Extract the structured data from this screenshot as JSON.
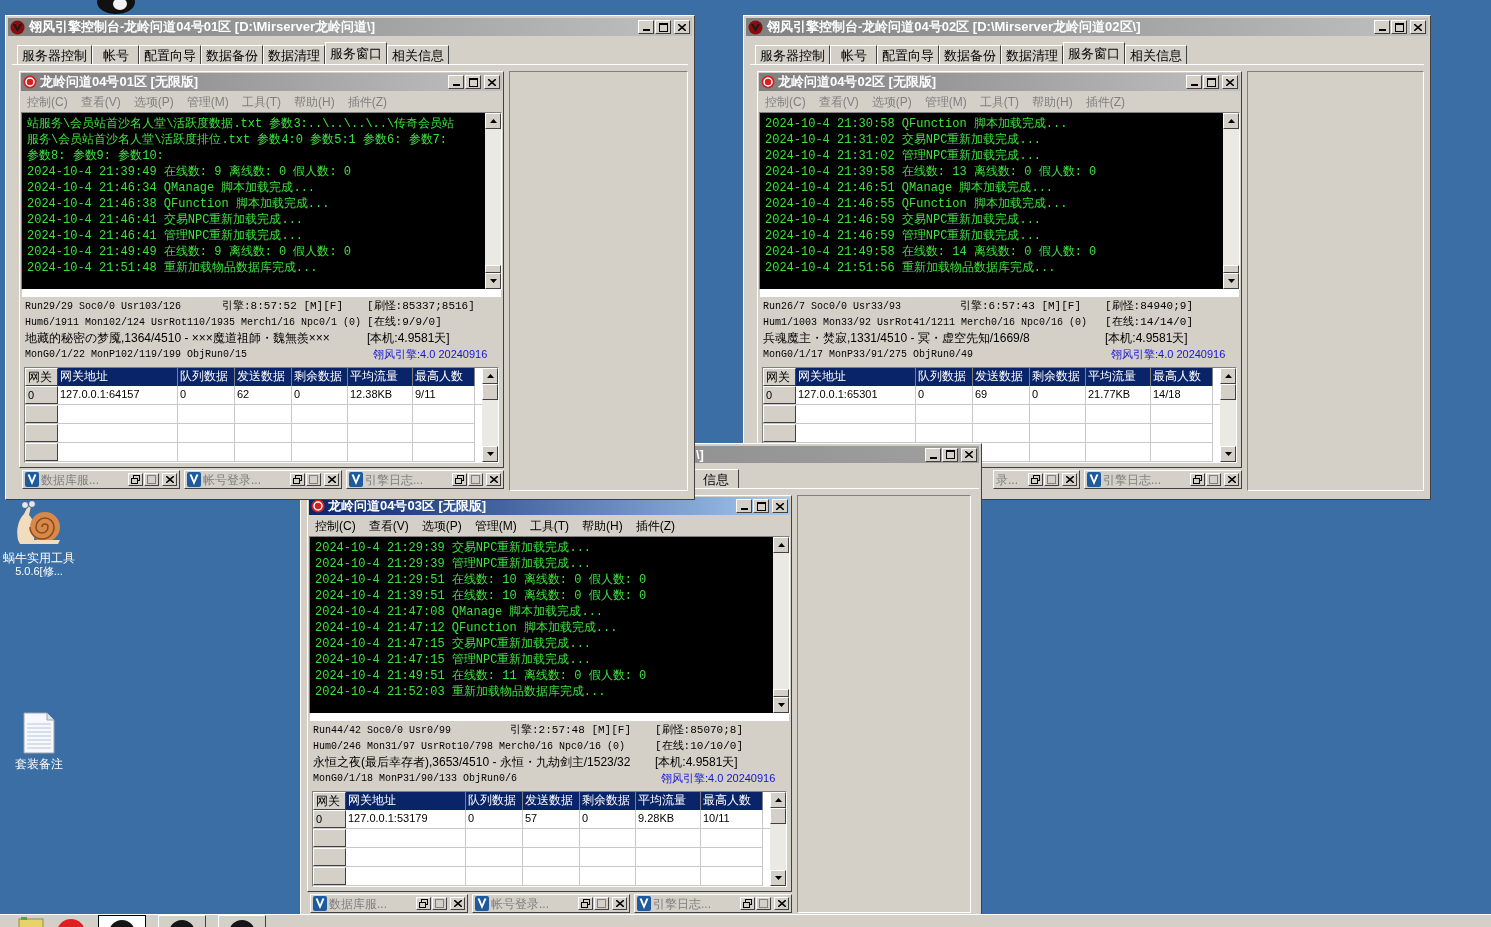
{
  "desktop": {
    "icons": [
      {
        "kind": "snail",
        "label": "蜗牛实用工具",
        "sublabel": "5.0.6[修..."
      },
      {
        "kind": "document",
        "label": "套装备注"
      }
    ]
  },
  "windows": [
    {
      "title": "翎风引擎控制台-龙岭问道04号01区 [D:\\Mirserver龙岭问道\\]",
      "tabs": [
        {
          "label": "服务器控制",
          "selected": false
        },
        {
          "label": "帐号",
          "selected": false
        },
        {
          "label": "配置向导",
          "selected": false
        },
        {
          "label": "数据备份",
          "selected": false
        },
        {
          "label": "数据清理",
          "selected": false
        },
        {
          "label": "服务窗口",
          "selected": true
        },
        {
          "label": "相关信息",
          "selected": false
        }
      ],
      "child": {
        "title": "龙岭问道04号01区 [无限版]",
        "active": false,
        "menu": [
          "控制(C)",
          "查看(V)",
          "选项(P)",
          "管理(M)",
          "工具(T)",
          "帮助(H)",
          "插件(Z)"
        ],
        "log": [
          "站服务\\会员站首沙名人堂\\活跃度数据.txt 参数3:..\\..\\..\\..\\传奇会员站",
          "服务\\会员站首沙名人堂\\活跃度排位.txt 参数4:0 参数5:1 参数6: 参数7:",
          "参数8: 参数9: 参数10:",
          "2024-10-4 21:39:49 在线数: 9 离线数: 0 假人数: 0",
          "2024-10-4 21:46:34 QManage 脚本加载完成...",
          "2024-10-4 21:46:38 QFunction 脚本加载完成...",
          "2024-10-4 21:46:41 交易NPC重新加载完成...",
          "2024-10-4 21:46:41 管理NPC重新加载完成...",
          "2024-10-4 21:49:49 在线数: 9 离线数: 0 假人数: 0",
          "2024-10-4 21:51:48 重新加载物品数据库完成..."
        ],
        "status": [
          {
            "kind": "counters",
            "cells": [
              "Run29/29 Soc0/0 Usr103/126",
              "引擎:8:57:52 [M][F]",
              "[刷怪:85337;8516]"
            ]
          },
          {
            "kind": "counters",
            "cells": [
              "Hum6/1911 Mon102/124 UsrRot110/1935 Merch1/16 Npc0/1 (0)",
              "[在线:9/9/0]"
            ]
          },
          {
            "kind": "names",
            "cells": [
              "地藏的秘密の梦魇,1364/4510 - ×××魔道祖師・魏無羨×××",
              "[本机:4.9581天]"
            ]
          },
          {
            "kind": "counters",
            "cells": [
              "MonG0/1/22 MonP102/119/199 ObjRun0/15"
            ],
            "version": "翎风引擎:4.0 20240916"
          }
        ],
        "table": {
          "columns": [
            "网关",
            "网关地址",
            "队列数据",
            "发送数据",
            "剩余数据",
            "平均流量",
            "最高人数"
          ],
          "rows": [
            [
              "0",
              "127.0.0.1:64157",
              "0",
              "62",
              "0",
              "12.38KB",
              "9/11"
            ]
          ]
        }
      },
      "minimized": [
        {
          "kind": "full",
          "label": "数据库服..."
        },
        {
          "kind": "full",
          "label": "帐号登录..."
        },
        {
          "kind": "full",
          "label": "引擎日志..."
        }
      ]
    },
    {
      "title": "翎风引擎控制台-龙岭问道04号02区 [D:\\Mirserver龙岭问道02区\\]",
      "tabs": [
        {
          "label": "服务器控制",
          "selected": false
        },
        {
          "label": "帐号",
          "selected": false
        },
        {
          "label": "配置向导",
          "selected": false
        },
        {
          "label": "数据备份",
          "selected": false
        },
        {
          "label": "数据清理",
          "selected": false
        },
        {
          "label": "服务窗口",
          "selected": true
        },
        {
          "label": "相关信息",
          "selected": false
        }
      ],
      "child": {
        "title": "龙岭问道04号02区 [无限版]",
        "active": false,
        "menu": [
          "控制(C)",
          "查看(V)",
          "选项(P)",
          "管理(M)",
          "工具(T)",
          "帮助(H)",
          "插件(Z)"
        ],
        "log": [
          "2024-10-4 21:30:58 QFunction 脚本加载完成...",
          "2024-10-4 21:31:02 交易NPC重新加载完成...",
          "2024-10-4 21:31:02 管理NPC重新加载完成...",
          "2024-10-4 21:39:58 在线数: 13 离线数: 0 假人数: 0",
          "2024-10-4 21:46:51 QManage 脚本加载完成...",
          "2024-10-4 21:46:55 QFunction 脚本加载完成...",
          "2024-10-4 21:46:59 交易NPC重新加载完成...",
          "2024-10-4 21:46:59 管理NPC重新加载完成...",
          "2024-10-4 21:49:58 在线数: 14 离线数: 0 假人数: 0",
          "2024-10-4 21:51:56 重新加载物品数据库完成..."
        ],
        "status": [
          {
            "kind": "counters",
            "cells": [
              "Run26/7 Soc0/0 Usr33/93",
              "引擎:6:57:43 [M][F]",
              "[刷怪:84940;9]"
            ]
          },
          {
            "kind": "counters",
            "cells": [
              "Hum1/1003 Mon33/92 UsrRot41/1211 Merch0/16 Npc0/16 (0)",
              "[在线:14/14/0]"
            ]
          },
          {
            "kind": "names",
            "cells": [
              "兵魂魔主・焚寂,1331/4510 - 冥・虚空先知/1669/8",
              "[本机:4.9581天]"
            ]
          },
          {
            "kind": "counters",
            "cells": [
              "MonG0/1/17 MonP33/91/275 ObjRun0/49"
            ],
            "version": "翎风引擎:4.0 20240916"
          }
        ],
        "table": {
          "columns": [
            "网关",
            "网关地址",
            "队列数据",
            "发送数据",
            "剩余数据",
            "平均流量",
            "最高人数"
          ],
          "rows": [
            [
              "0",
              "127.0.0.1:65301",
              "0",
              "69",
              "0",
              "21.77KB",
              "14/18"
            ]
          ]
        }
      },
      "minimized": [
        {
          "kind": "clipped",
          "label": "录..."
        },
        {
          "kind": "full",
          "label": "引擎日志..."
        }
      ]
    }
  ],
  "front_window": {
    "title": "\\]",
    "tabs": [
      {
        "label": "信息",
        "selected": false
      }
    ],
    "child": {
      "title": "龙岭问道04号03区 [无限版]",
      "active": true,
      "menu": [
        "控制(C)",
        "查看(V)",
        "选项(P)",
        "管理(M)",
        "工具(T)",
        "帮助(H)",
        "插件(Z)"
      ],
      "log": [
        "2024-10-4 21:29:39 交易NPC重新加载完成...",
        "2024-10-4 21:29:39 管理NPC重新加载完成...",
        "2024-10-4 21:29:51 在线数: 10 离线数: 0 假人数: 0",
        "2024-10-4 21:39:51 在线数: 10 离线数: 0 假人数: 0",
        "2024-10-4 21:47:08 QManage 脚本加载完成...",
        "2024-10-4 21:47:12 QFunction 脚本加载完成...",
        "2024-10-4 21:47:15 交易NPC重新加载完成...",
        "2024-10-4 21:47:15 管理NPC重新加载完成...",
        "2024-10-4 21:49:51 在线数: 11 离线数: 0 假人数: 0",
        "2024-10-4 21:52:03 重新加载物品数据库完成..."
      ],
      "status": [
        {
          "kind": "counters",
          "cells": [
            "Run44/42 Soc0/0 Usr0/99",
            "引擎:2:57:48 [M][F]",
            "[刷怪:85070;8]"
          ]
        },
        {
          "kind": "counters",
          "cells": [
            "Hum0/246 Mon31/97 UsrRot10/798 Merch0/16 Npc0/16 (0)",
            "[在线:10/10/0]"
          ]
        },
        {
          "kind": "names",
          "cells": [
            "永恒之夜(最后幸存者),3653/4510 - 永恒・九劫剑主/1523/32",
            "[本机:4.9581天]"
          ]
        },
        {
          "kind": "counters",
          "cells": [
            "MonG0/1/18 MonP31/90/133 ObjRun0/6"
          ],
          "version": "翎风引擎:4.0 20240916"
        }
      ],
      "table": {
        "columns": [
          "网关",
          "网关地址",
          "队列数据",
          "发送数据",
          "剩余数据",
          "平均流量",
          "最高人数"
        ],
        "rows": [
          [
            "0",
            "127.0.0.1:53179",
            "0",
            "57",
            "0",
            "9.28KB",
            "10/11"
          ]
        ]
      }
    },
    "minimized": [
      {
        "kind": "full",
        "label": "数据库服..."
      },
      {
        "kind": "full",
        "label": "帐号登录..."
      },
      {
        "kind": "full",
        "label": "引擎日志..."
      }
    ]
  }
}
